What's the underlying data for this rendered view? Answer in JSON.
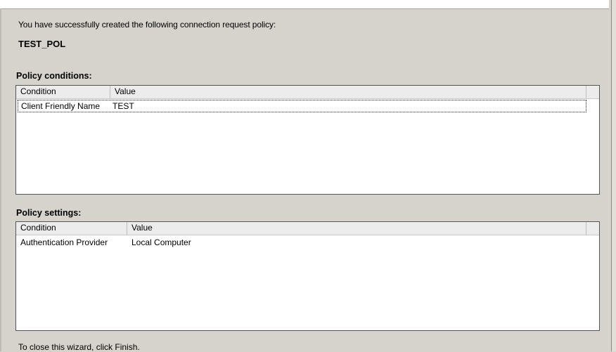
{
  "summary": {
    "intro_text": "You have successfully created the following connection request policy:",
    "policy_name": "TEST_POL"
  },
  "policy_conditions": {
    "label": "Policy conditions:",
    "columns": [
      "Condition",
      "Value"
    ],
    "rows": [
      {
        "condition": "Client Friendly Name",
        "value": "TEST"
      }
    ]
  },
  "policy_settings": {
    "label": "Policy settings:",
    "columns": [
      "Condition",
      "Value"
    ],
    "rows": [
      {
        "condition": "Authentication Provider",
        "value": "Local Computer"
      }
    ]
  },
  "footer": {
    "closing_text": "To close this wizard, click Finish."
  }
}
